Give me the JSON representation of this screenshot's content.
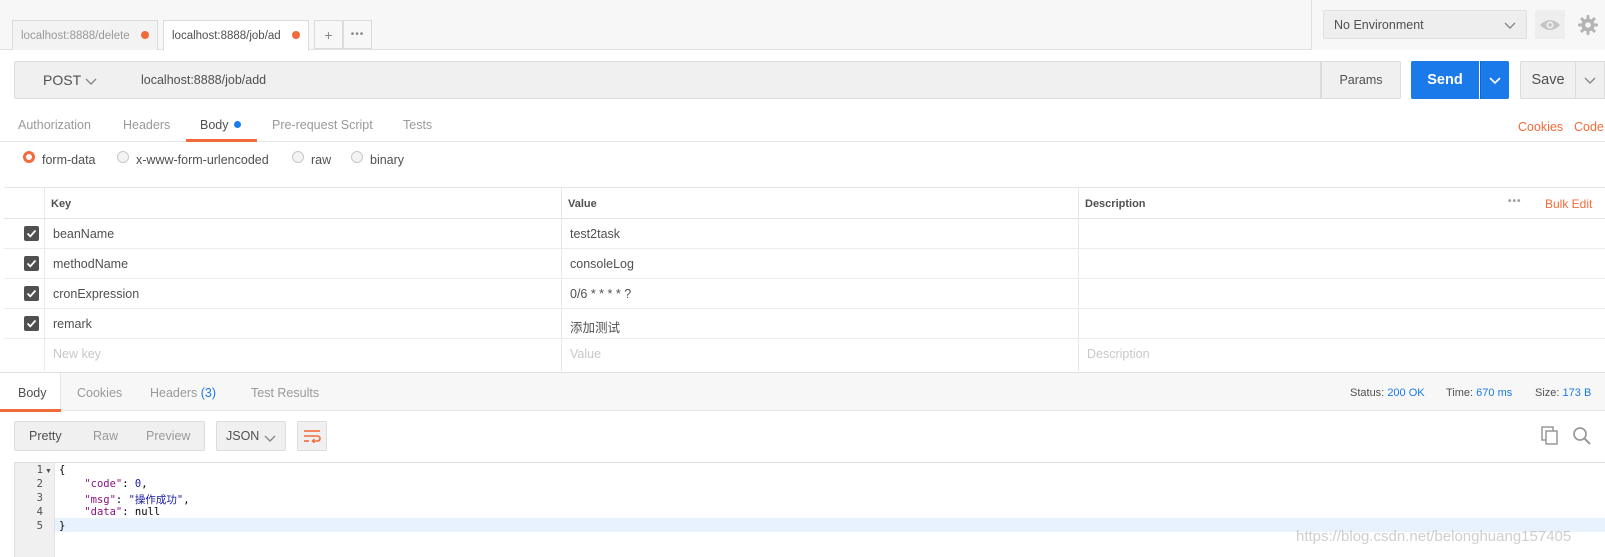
{
  "tabs": [
    {
      "title": "localhost:8888/delete",
      "unsaved": true
    },
    {
      "title": "localhost:8888/job/ad",
      "unsaved": true
    }
  ],
  "tab_actions": {
    "new_tab": "+",
    "more": "•••"
  },
  "environment": {
    "selected": "No Environment"
  },
  "request": {
    "method": "POST",
    "url": "localhost:8888/job/add",
    "params_label": "Params",
    "send_label": "Send",
    "save_label": "Save"
  },
  "request_tabs": [
    {
      "label": "Authorization"
    },
    {
      "label": "Headers"
    },
    {
      "label": "Body",
      "active": true
    },
    {
      "label": "Pre-request Script"
    },
    {
      "label": "Tests"
    }
  ],
  "request_links": {
    "cookies": "Cookies",
    "code": "Code"
  },
  "body_types": [
    {
      "label": "form-data",
      "selected": true
    },
    {
      "label": "x-www-form-urlencoded"
    },
    {
      "label": "raw"
    },
    {
      "label": "binary"
    }
  ],
  "form_table": {
    "headers": {
      "key": "Key",
      "value": "Value",
      "description": "Description",
      "more": "•••",
      "bulk_edit": "Bulk Edit"
    },
    "rows": [
      {
        "key": "beanName",
        "value": "test2task",
        "checked": true
      },
      {
        "key": "methodName",
        "value": "consoleLog",
        "checked": true
      },
      {
        "key": "cronExpression",
        "value": "0/6 * * * * ?",
        "checked": true
      },
      {
        "key": "remark",
        "value": "添加测试",
        "checked": true
      }
    ],
    "placeholder": {
      "key": "New key",
      "value": "Value",
      "description": "Description"
    }
  },
  "response_tabs": [
    {
      "label": "Body",
      "active": true
    },
    {
      "label": "Cookies"
    },
    {
      "label": "Headers",
      "count": "(3)"
    },
    {
      "label": "Test Results"
    }
  ],
  "response_status": {
    "status_label": "Status:",
    "status": "200 OK",
    "time_label": "Time:",
    "time": "670 ms",
    "size_label": "Size:",
    "size": "173 B"
  },
  "view_modes": [
    {
      "label": "Pretty",
      "active": true
    },
    {
      "label": "Raw"
    },
    {
      "label": "Preview"
    }
  ],
  "format": "JSON",
  "code_lines": [
    "1",
    "2",
    "3",
    "4",
    "5"
  ],
  "response_json": {
    "open": "{",
    "code_key": "\"code\"",
    "code_val": "0",
    "msg_key": "\"msg\"",
    "msg_val": "\"操作成功\"",
    "data_key": "\"data\"",
    "data_val": "null",
    "close": "}"
  },
  "watermark": "https://blog.csdn.net/belonghuang157405",
  "colors": {
    "accent": "#f26b3a",
    "primary": "#1a7ae9"
  },
  "icons": [
    "chevron-down-icon",
    "eye-icon",
    "gear-icon",
    "checkbox-checked-icon",
    "wrap-lines-icon",
    "copy-icon",
    "search-icon"
  ]
}
